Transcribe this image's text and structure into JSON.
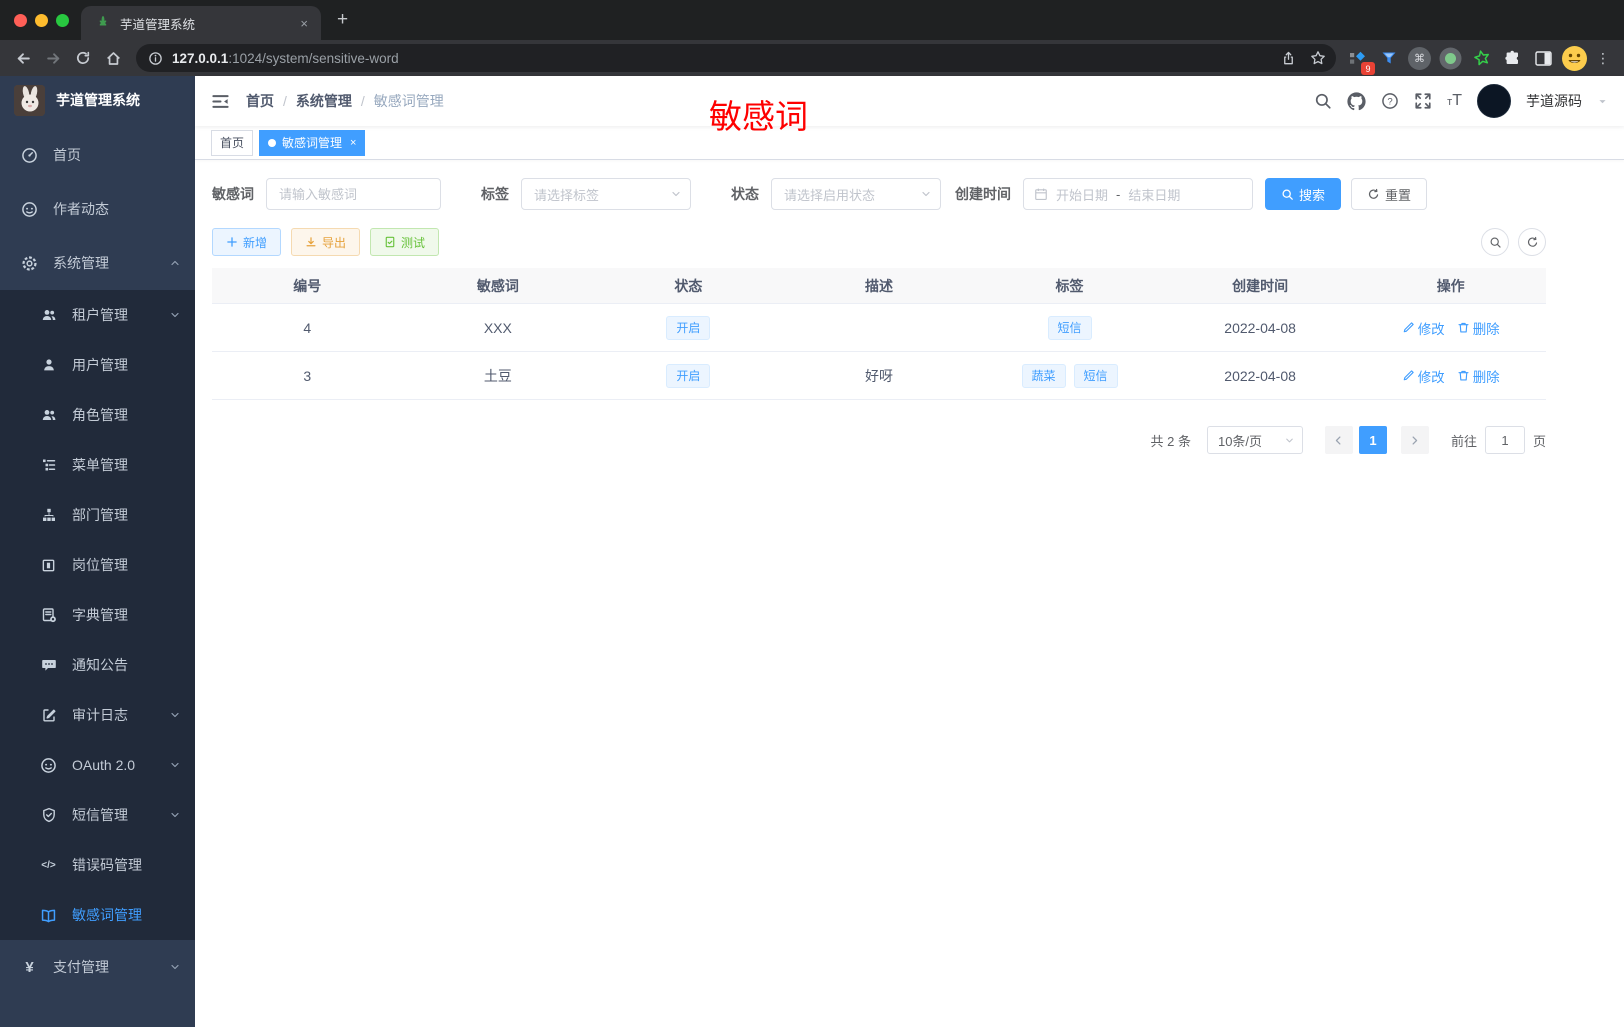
{
  "browser": {
    "tab_title": "芋道管理系统",
    "new_tab_label": "+",
    "close_tab_label": "×",
    "url_host": "127.0.0.1",
    "url_rest": ":1024/system/sensitive-word",
    "extension_badge": "9",
    "command_glyph": "⌘",
    "menu_dots": "⋮"
  },
  "sidebar": {
    "app_title": "芋道管理系统",
    "items": [
      {
        "label": "首页",
        "icon": "dashboard-icon"
      },
      {
        "label": "作者动态",
        "icon": "author-feed-icon"
      },
      {
        "label": "系统管理",
        "icon": "gear-icon",
        "expanded": true
      },
      {
        "label": "租户管理",
        "icon": "tenants-icon",
        "arrow": "down"
      },
      {
        "label": "用户管理",
        "icon": "user-icon"
      },
      {
        "label": "角色管理",
        "icon": "roles-icon"
      },
      {
        "label": "菜单管理",
        "icon": "menu-tree-icon"
      },
      {
        "label": "部门管理",
        "icon": "org-chart-icon"
      },
      {
        "label": "岗位管理",
        "icon": "post-badge-icon"
      },
      {
        "label": "字典管理",
        "icon": "dictionary-icon"
      },
      {
        "label": "通知公告",
        "icon": "announcement-icon"
      },
      {
        "label": "审计日志",
        "icon": "audit-log-icon",
        "arrow": "down"
      },
      {
        "label": "OAuth 2.0",
        "icon": "oauth-icon",
        "arrow": "down"
      },
      {
        "label": "短信管理",
        "icon": "shield-icon",
        "arrow": "down"
      },
      {
        "label": "错误码管理",
        "icon": "code-icon",
        "code_glyph": "</>"
      },
      {
        "label": "敏感词管理",
        "icon": "open-book-icon",
        "active": true
      },
      {
        "label": "支付管理",
        "icon": "yen-icon",
        "yen_glyph": "¥",
        "arrow": "down"
      }
    ]
  },
  "header": {
    "breadcrumb": [
      "首页",
      "系统管理",
      "敏感词管理"
    ],
    "separator": "/",
    "annotation": "敏感词",
    "username": "芋道源码",
    "icons": [
      "search-icon",
      "github-icon",
      "help-icon",
      "fullscreen-icon",
      "font-size-icon"
    ]
  },
  "tabs": [
    {
      "label": "首页"
    },
    {
      "label": "敏感词管理",
      "close": "×",
      "active": true
    }
  ],
  "filters": {
    "keyword_label": "敏感词",
    "keyword_placeholder": "请输入敏感词",
    "tag_label": "标签",
    "tag_placeholder": "请选择标签",
    "status_label": "状态",
    "status_placeholder": "请选择启用状态",
    "date_label": "创建时间",
    "date_start_placeholder": "开始日期",
    "date_separator": "-",
    "date_end_placeholder": "结束日期",
    "search_label": "搜索",
    "reset_label": "重置"
  },
  "toolbar": {
    "add_label": "新增",
    "export_label": "导出",
    "test_label": "测试"
  },
  "table": {
    "columns": [
      "编号",
      "敏感词",
      "状态",
      "描述",
      "标签",
      "创建时间",
      "操作"
    ],
    "edit_label": "修改",
    "delete_label": "删除",
    "rows": [
      {
        "id": "4",
        "word": "XXX",
        "status": "开启",
        "description": "",
        "tags": [
          "短信"
        ],
        "created": "2022-04-08"
      },
      {
        "id": "3",
        "word": "土豆",
        "status": "开启",
        "description": "好呀",
        "tags": [
          "蔬菜",
          "短信"
        ],
        "created": "2022-04-08"
      }
    ]
  },
  "pagination": {
    "total_text": "共 2 条",
    "page_size": "10条/页",
    "current_page": "1",
    "goto_label": "前往",
    "goto_value": "1",
    "page_unit": "页"
  },
  "colors": {
    "accent": "#409eff",
    "sidebar_bg": "#2f3c52",
    "submenu_bg": "#212a3a",
    "annotation_red": "#fe0000",
    "warning": "#e6a23c",
    "success": "#67c23a"
  }
}
